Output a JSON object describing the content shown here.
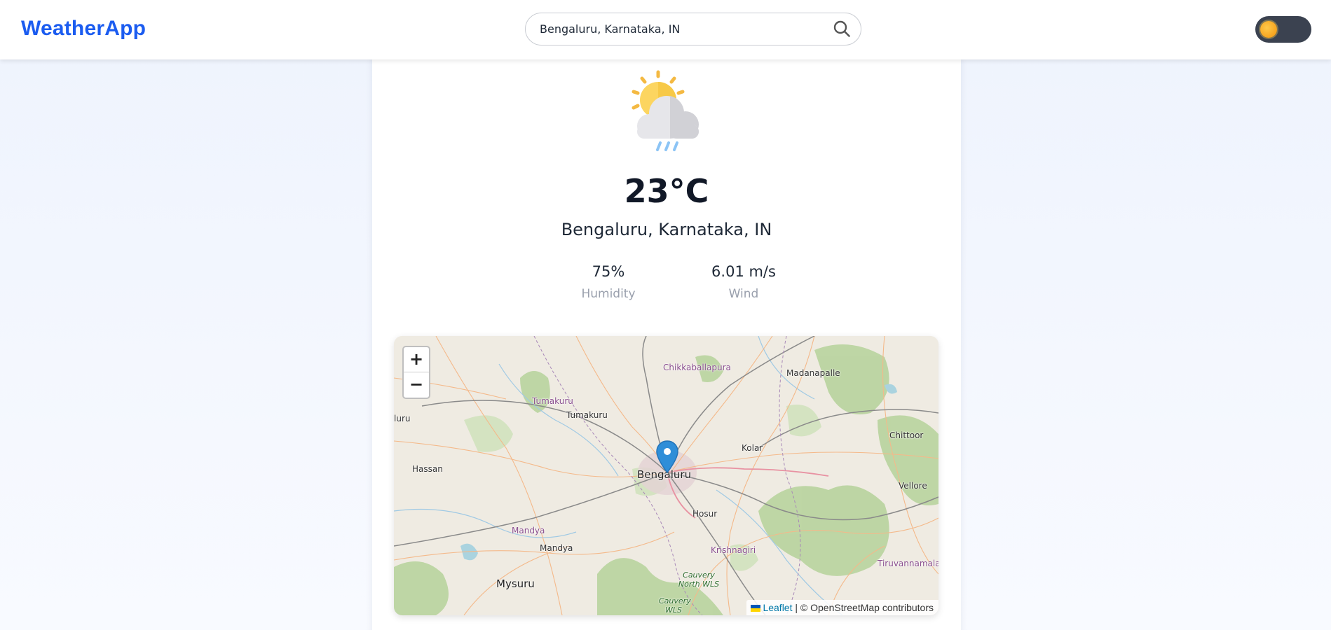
{
  "header": {
    "brand": "WeatherApp",
    "search": {
      "value": "Bengaluru, Karnataka, IN",
      "icon": "search-icon"
    },
    "theme_toggle": {
      "icon": "sun-icon",
      "state": "light"
    }
  },
  "weather": {
    "icon": "sun-cloud-rain-icon",
    "temperature": "23°C",
    "location": "Bengaluru, Karnataka, IN",
    "stats": [
      {
        "value": "75%",
        "label": "Humidity"
      },
      {
        "value": "6.01 m/s",
        "label": "Wind"
      }
    ]
  },
  "map": {
    "zoom_in": "+",
    "zoom_out": "−",
    "marker_icon": "map-pin-icon",
    "place_labels": {
      "chikkaballapura": "Chikkaballapura",
      "madanapalle": "Madanapalle",
      "tumakuru_region": "Tumakuru",
      "tumakuru": "Tumakuru",
      "luru": "luru",
      "chittoor": "Chittoor",
      "kolar": "Kolar",
      "hassan": "Hassan",
      "bengaluru": "Bengaluru",
      "vellore": "Vellore",
      "hosur": "Hosur",
      "mandya_region": "Mandya",
      "mandya": "Mandya",
      "krishnagiri": "Krishnagiri",
      "tiruvannamalai": "Tiruvannamalai",
      "cauvery_north_wls": "Cauvery North WLS",
      "cauvery_wls": "Cauvery WLS",
      "mysuru": "Mysuru"
    },
    "attribution": {
      "leaflet": "Leaflet",
      "rest": "| © OpenStreetMap contributors"
    }
  },
  "colors": {
    "accent": "#1b5cf0",
    "marker": "#2f8ed8",
    "toggle_bg": "#3b4250"
  }
}
